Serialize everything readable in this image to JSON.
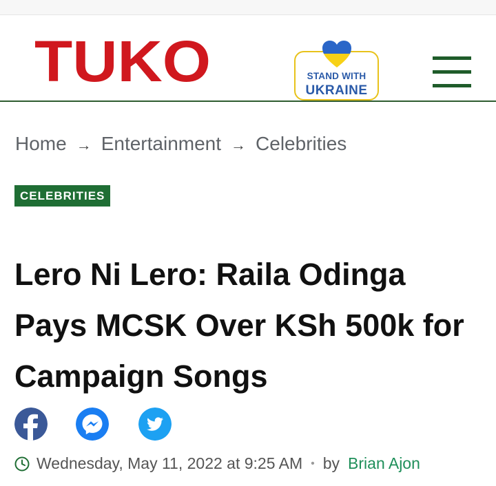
{
  "header": {
    "logo_text": "TUKO",
    "ukraine_line1": "STAND WITH",
    "ukraine_line2": "UKRAINE"
  },
  "breadcrumb": {
    "items": [
      "Home",
      "Entertainment",
      "Celebrities"
    ],
    "separator": "→"
  },
  "category_tag": "CELEBRITIES",
  "article": {
    "title": "Lero Ni Lero: Raila Odinga Pays MCSK Over KSh 500k for Campaign Songs",
    "date": "Wednesday, May 11, 2022 at 9:25 AM",
    "separator": "•",
    "by_label": "by",
    "author": "Brian Ajon"
  },
  "share_icons": [
    "facebook-icon",
    "messenger-icon",
    "twitter-icon"
  ],
  "colors": {
    "logo_red": "#d0181e",
    "header_rule": "#2d5b2f",
    "menu_green": "#1f5c2a",
    "tag_bg": "#1f6e34",
    "facebook": "#3b5998",
    "messenger": "#1a7ef2",
    "twitter": "#1da1f2",
    "author": "#1f8f5a",
    "ukraine_blue": "#2a5aa8",
    "ukraine_yellow": "#f7d117"
  }
}
